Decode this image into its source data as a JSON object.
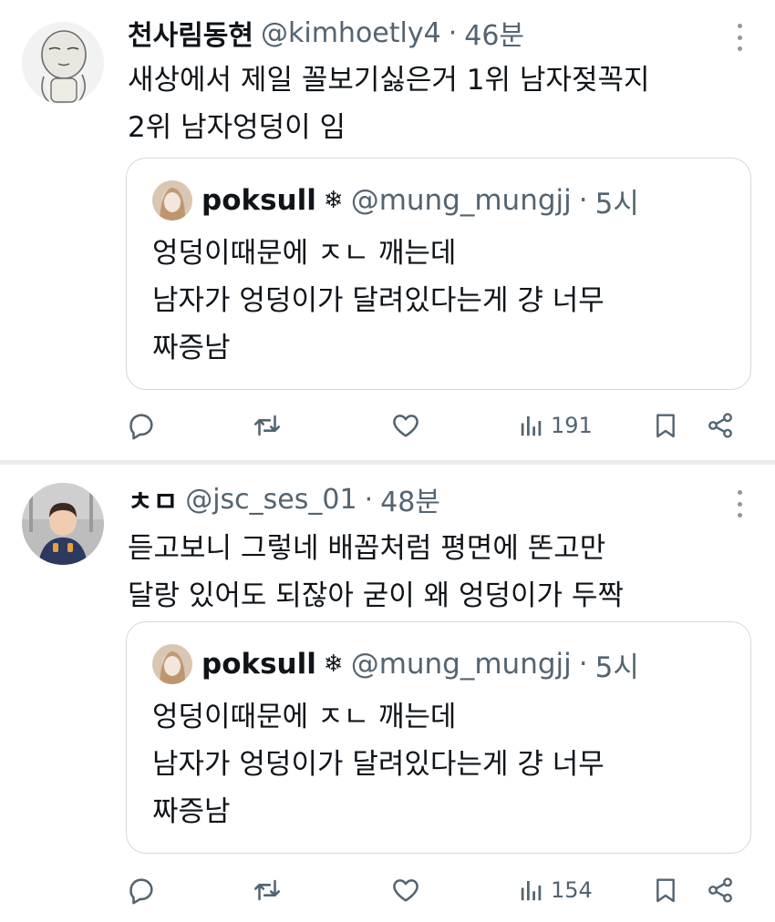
{
  "tweets": [
    {
      "author": {
        "name": "천사림동현",
        "handle": "@kimhoetly4",
        "time": "46분"
      },
      "text_lines": [
        "새상에서 제일 꼴보기싫은거 1위 남자젖꼭지",
        "2위 남자엉덩이 임"
      ],
      "quote": {
        "name": "poksull",
        "badge": "❄",
        "handle": "@mung_mungjj",
        "time": "5시",
        "text_lines": [
          "엉덩이때문에 ㅈㄴ 깨는데",
          "남자가 엉덩이가 달려있다는게 걍 너무",
          "짜증남"
        ]
      },
      "views": "191",
      "icons": {
        "more": "more-icon",
        "reply": "reply-icon",
        "retweet": "retweet-icon",
        "like": "like-icon",
        "views": "views-icon",
        "bookmark": "bookmark-icon",
        "share": "share-icon"
      }
    },
    {
      "author": {
        "name": "ㅊㅁ",
        "handle": "@jsc_ses_01",
        "time": "48분"
      },
      "text_lines": [
        "듣고보니 그렇네 배꼽처럼 평면에 똔고만",
        "달랑 있어도 되잖아 굳이 왜 엉덩이가 두짝"
      ],
      "quote": {
        "name": "poksull",
        "badge": "❄",
        "handle": "@mung_mungjj",
        "time": "5시",
        "text_lines": [
          "엉덩이때문에 ㅈㄴ 깨는데",
          "남자가 엉덩이가 달려있다는게 걍 너무",
          "짜증남"
        ]
      },
      "views": "154"
    }
  ],
  "separator": "·",
  "colors": {
    "text": "#0f1419",
    "secondary": "#536471",
    "border": "#cfd9de",
    "divider": "#e9ecef"
  }
}
